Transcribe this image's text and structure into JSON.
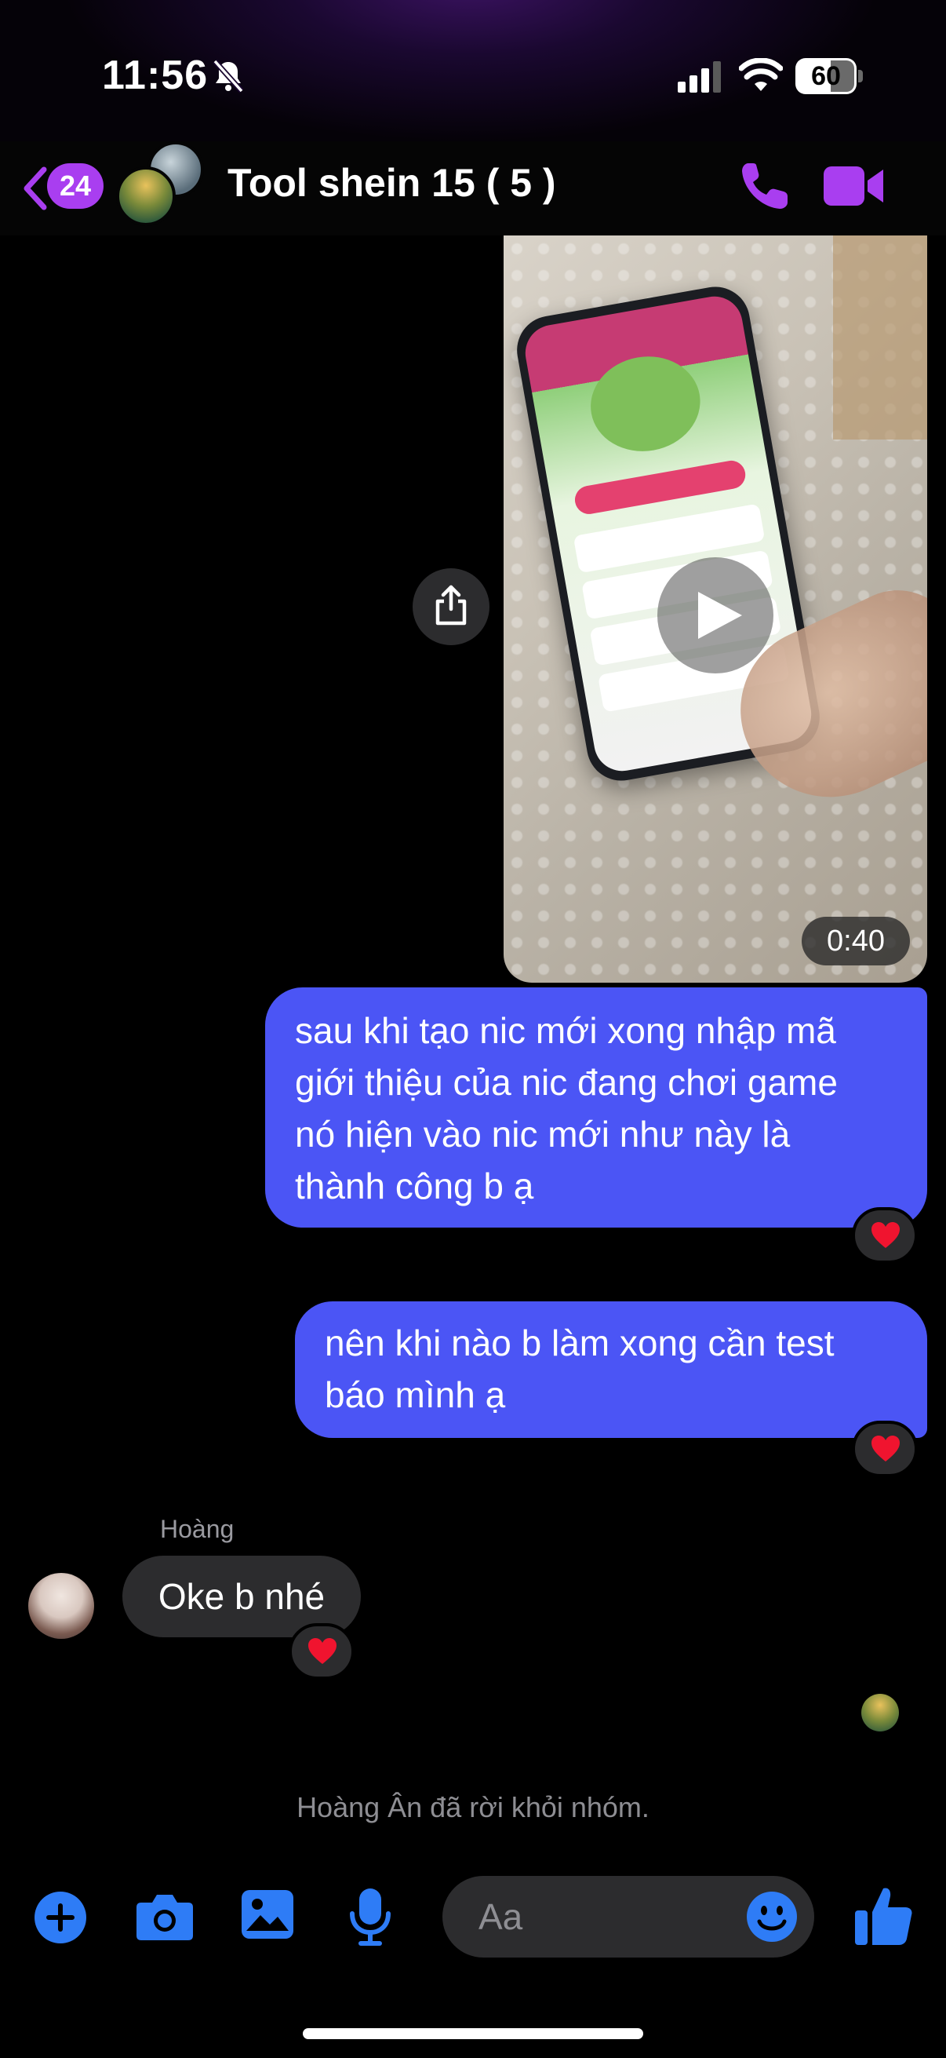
{
  "status_bar": {
    "time": "11:56",
    "battery_level": "60",
    "icons": [
      "bell-slash-icon",
      "cellular-signal-icon",
      "wifi-icon",
      "battery-icon"
    ]
  },
  "header": {
    "unread_count": "24",
    "title": "Tool shein 15 ( 5 )",
    "accent_color": "#a93ef0",
    "icons": [
      "chevron-left-icon",
      "phone-icon",
      "video-camera-icon"
    ]
  },
  "messages": {
    "video": {
      "duration": "0:40",
      "icons": [
        "play-icon",
        "share-icon"
      ]
    },
    "outgoing_1": {
      "lines": [
        "sau khi tạo nic mới xong nhập mã",
        "giới thiệu của nic đang chơi game",
        "nó hiện vào nic mới như này là",
        "thành công b ạ"
      ],
      "reaction": "heart-icon"
    },
    "outgoing_2": {
      "lines": [
        "nên khi nào b làm xong cần test",
        "báo mình ạ"
      ],
      "reaction": "heart-icon"
    },
    "incoming_1": {
      "sender": "Hoàng",
      "text": "Oke b nhé",
      "reaction": "heart-icon"
    },
    "system": "Hoàng Ân đã rời khỏi nhóm.",
    "bubble_color_outgoing": "#4b55f5",
    "bubble_color_incoming": "#2c2c2e"
  },
  "composer": {
    "placeholder": "Aa",
    "icon_color": "#2e7cf6",
    "icons": [
      "plus-icon",
      "camera-icon",
      "gallery-icon",
      "microphone-icon",
      "emoji-icon",
      "thumbs-up-icon"
    ]
  }
}
